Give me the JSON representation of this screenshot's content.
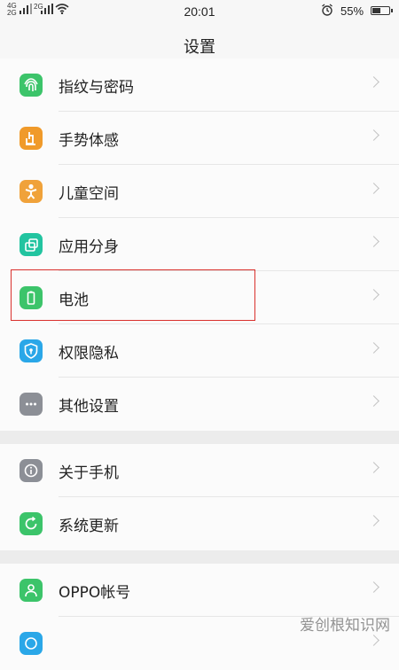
{
  "status_bar": {
    "network_top": "4G",
    "network_bottom": "2G",
    "time": "20:01",
    "battery_percent": "55%",
    "battery_level": 0.55
  },
  "nav": {
    "title": "设置"
  },
  "groups": [
    {
      "items": [
        {
          "label": "指纹与密码",
          "icon": "fingerprint-icon",
          "color": "#3cc46a"
        },
        {
          "label": "手势体感",
          "icon": "hand-gesture-icon",
          "color": "#f09a2a"
        },
        {
          "label": "儿童空间",
          "icon": "child-icon",
          "color": "#f0a23a"
        },
        {
          "label": "应用分身",
          "icon": "app-clone-icon",
          "color": "#22c4a0"
        },
        {
          "label": "电池",
          "icon": "battery-icon",
          "color": "#3cc46a"
        },
        {
          "label": "权限隐私",
          "icon": "shield-icon",
          "color": "#2aa7e8"
        },
        {
          "label": "其他设置",
          "icon": "more-icon",
          "color": "#8c8f96"
        }
      ]
    },
    {
      "items": [
        {
          "label": "关于手机",
          "icon": "info-icon",
          "color": "#8c8f96"
        },
        {
          "label": "系统更新",
          "icon": "update-icon",
          "color": "#3cc46a"
        }
      ]
    },
    {
      "items": [
        {
          "label": "OPPO帐号",
          "icon": "account-icon",
          "color": "#3cc46a"
        },
        {
          "label": "",
          "icon": "help-icon",
          "color": "#2aa7e8"
        }
      ]
    }
  ],
  "highlight_color": "#d9302c",
  "watermark": "爱创根知识网"
}
